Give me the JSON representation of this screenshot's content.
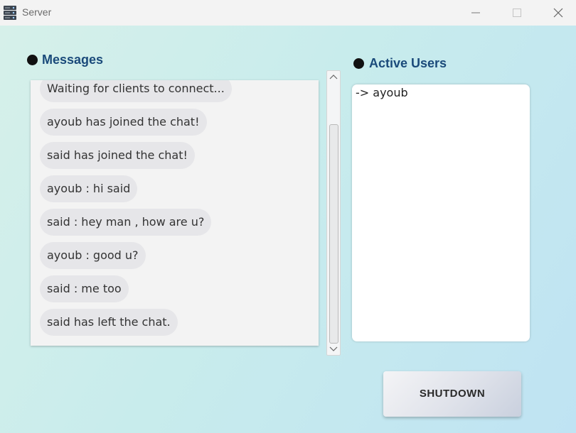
{
  "window": {
    "title": "Server",
    "icon": "server-icon",
    "controls": [
      "minimize-icon",
      "maximize-icon",
      "close-icon"
    ]
  },
  "messages": {
    "heading": "Messages",
    "items": [
      "Waiting for clients to connect...",
      "ayoub has joined the chat!",
      "said has joined the chat!",
      "ayoub : hi said",
      "said : hey man , how are u?",
      "ayoub : good u?",
      "said : me too",
      "said has left the chat."
    ]
  },
  "active_users": {
    "heading": "Active Users",
    "items": [
      "-> ayoub"
    ]
  },
  "actions": {
    "shutdown_label": "SHUTDOWN"
  },
  "colors": {
    "heading": "#1a4a7a",
    "bubble": "#e6e6e9",
    "background_start": "#d6f0ea",
    "background_end": "#bfe3f3"
  }
}
